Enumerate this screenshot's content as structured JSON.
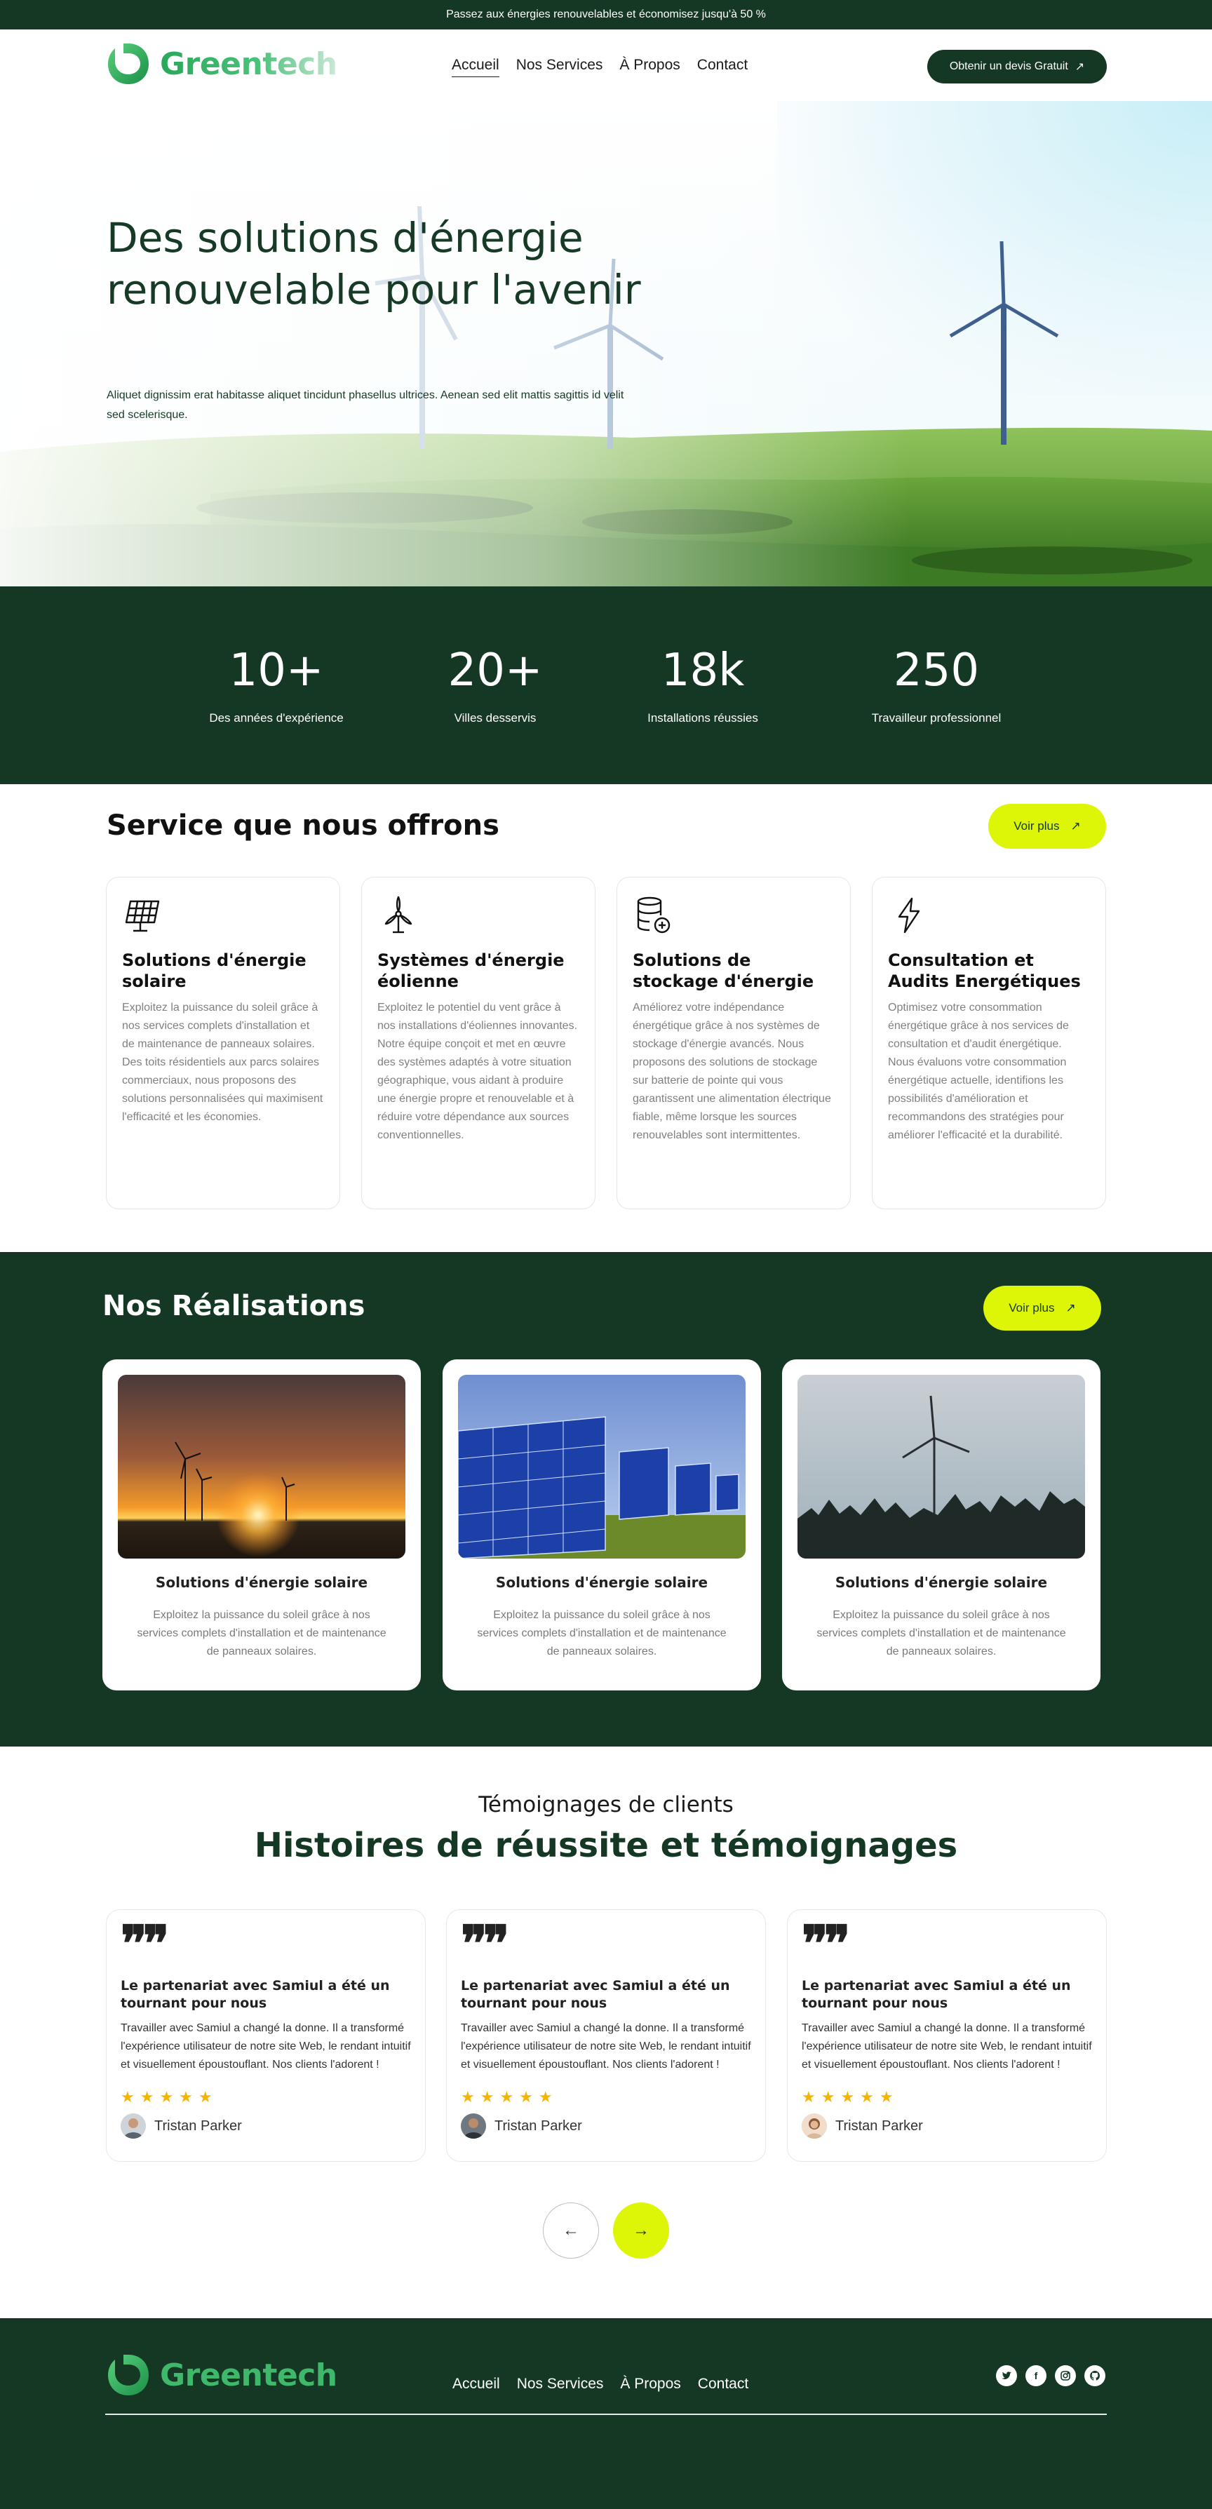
{
  "topbar": {
    "text": "Passez aux énergies renouvelables et économisez jusqu'à 50 %"
  },
  "brand": {
    "name": "Greentech",
    "color": "#143823",
    "accent": "#ddf506",
    "logo_color": "#2aa85a"
  },
  "nav": {
    "items": [
      {
        "label": "Accueil",
        "active": true
      },
      {
        "label": "Nos Services",
        "active": false
      },
      {
        "label": "À Propos",
        "active": false
      },
      {
        "label": "Contact",
        "active": false
      }
    ],
    "cta_label": "Obtenir un devis Gratuit"
  },
  "hero": {
    "title": "Des solutions d'énergie renouvelable pour l'avenir",
    "subtitle": "Aliquet dignissim erat habitasse aliquet tincidunt phasellus ultrices. Aenean sed elit mattis sagittis id velit sed scelerisque."
  },
  "stats": [
    {
      "value": "10+",
      "label": "Des années d'expérience"
    },
    {
      "value": "20+",
      "label": "Villes desservis"
    },
    {
      "value": "18k",
      "label": "Installations réussies"
    },
    {
      "value": "250",
      "label": "Travailleur professionnel"
    }
  ],
  "services": {
    "title": "Service que nous offrons",
    "more_label": "Voir plus",
    "items": [
      {
        "icon": "solar-panel-icon",
        "title": "Solutions d'énergie solaire",
        "text": "Exploitez la puissance du soleil grâce à nos services complets d'installation et de maintenance de panneaux solaires. Des toits résidentiels aux parcs solaires commerciaux, nous proposons des solutions personnalisées qui maximisent l'efficacité et les économies."
      },
      {
        "icon": "wind-turbine-icon",
        "title": "Systèmes d'énergie éolienne",
        "text": "Exploitez le potentiel du vent grâce à nos installations d'éoliennes innovantes. Notre équipe conçoit et met en œuvre des systèmes adaptés à votre situation géographique, vous aidant à produire une énergie propre et renouvelable et à réduire votre dépendance aux sources conventionnelles."
      },
      {
        "icon": "battery-storage-icon",
        "title": "Solutions de stockage d'énergie",
        "text": "Améliorez votre indépendance énergétique grâce à nos systèmes de stockage d'énergie avancés. Nous proposons des solutions de stockage sur batterie de pointe qui vous garantissent une alimentation électrique fiable, même lorsque les sources renouvelables sont intermittentes."
      },
      {
        "icon": "lightning-icon",
        "title": "Consultation et Audits Energétiques",
        "text": "Optimisez votre consommation énergétique grâce à nos services de consultation et d'audit énergétique. Nous évaluons votre consommation énergétique actuelle, identifions les possibilités d'amélioration et recommandons des stratégies pour améliorer l'efficacité et la durabilité."
      }
    ]
  },
  "realisations": {
    "title": "Nos Réalisations",
    "more_label": "Voir plus",
    "items": [
      {
        "image": "sunset-wind-farm-photo",
        "title": "Solutions d'énergie solaire",
        "text": "Exploitez la puissance du soleil grâce à nos services complets d'installation et de maintenance de panneaux solaires."
      },
      {
        "image": "solar-panels-photo",
        "title": "Solutions d'énergie solaire",
        "text": "Exploitez la puissance du soleil grâce à nos services complets d'installation et de maintenance de panneaux solaires."
      },
      {
        "image": "wind-turbine-forest-photo",
        "title": "Solutions d'énergie solaire",
        "text": "Exploitez la puissance du soleil grâce à nos services complets d'installation et de maintenance de panneaux solaires."
      }
    ]
  },
  "testimonials": {
    "kicker": "Témoignages de clients",
    "title": "Histoires de réussite et témoignages",
    "items": [
      {
        "heading": "Le partenariat avec Samiul a été un tournant pour nous",
        "body": "Travailler avec Samiul a changé la donne. Il a transformé l'expérience utilisateur de notre site Web, le rendant intuitif et visuellement époustouflant. Nos clients l'adorent !",
        "stars": "★★★★★",
        "rating": 5,
        "author": "Tristan Parker"
      },
      {
        "heading": "Le partenariat avec Samiul a été un tournant pour nous",
        "body": "Travailler avec Samiul a changé la donne. Il a transformé l'expérience utilisateur de notre site Web, le rendant intuitif et visuellement époustouflant. Nos clients l'adorent !",
        "stars": "★★★★★",
        "rating": 5,
        "author": "Tristan Parker"
      },
      {
        "heading": "Le partenariat avec Samiul a été un tournant pour nous",
        "body": "Travailler avec Samiul a changé la donne. Il a transformé l'expérience utilisateur de notre site Web, le rendant intuitif et visuellement époustouflant. Nos clients l'adorent !",
        "stars": "★★★★★",
        "rating": 5,
        "author": "Tristan Parker"
      }
    ],
    "prev_icon": "←",
    "next_icon": "→"
  },
  "footer": {
    "brand": "Greentech",
    "nav": [
      "Accueil",
      "Nos Services",
      "À Propos",
      "Contact"
    ],
    "socials": [
      {
        "icon": "twitter-icon"
      },
      {
        "icon": "facebook-icon",
        "glyph": "f"
      },
      {
        "icon": "instagram-icon"
      },
      {
        "icon": "github-icon"
      }
    ]
  }
}
